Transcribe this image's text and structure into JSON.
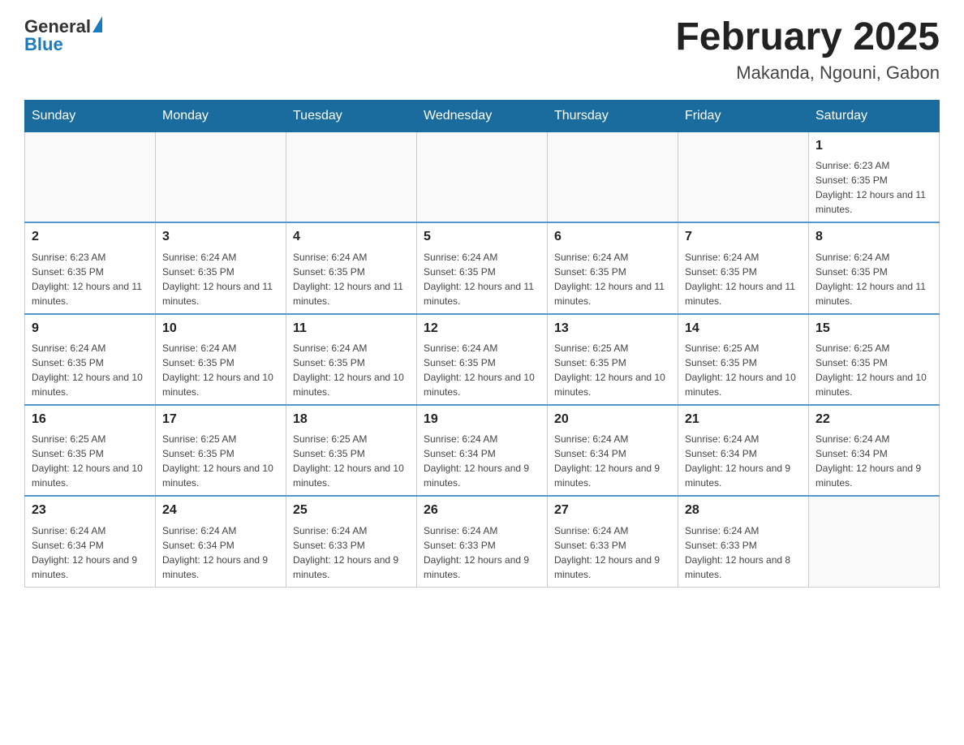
{
  "header": {
    "logo": {
      "general": "General",
      "blue": "Blue"
    },
    "title": "February 2025",
    "subtitle": "Makanda, Ngouni, Gabon"
  },
  "days_of_week": [
    "Sunday",
    "Monday",
    "Tuesday",
    "Wednesday",
    "Thursday",
    "Friday",
    "Saturday"
  ],
  "weeks": [
    [
      {
        "day": "",
        "info": ""
      },
      {
        "day": "",
        "info": ""
      },
      {
        "day": "",
        "info": ""
      },
      {
        "day": "",
        "info": ""
      },
      {
        "day": "",
        "info": ""
      },
      {
        "day": "",
        "info": ""
      },
      {
        "day": "1",
        "info": "Sunrise: 6:23 AM\nSunset: 6:35 PM\nDaylight: 12 hours and 11 minutes."
      }
    ],
    [
      {
        "day": "2",
        "info": "Sunrise: 6:23 AM\nSunset: 6:35 PM\nDaylight: 12 hours and 11 minutes."
      },
      {
        "day": "3",
        "info": "Sunrise: 6:24 AM\nSunset: 6:35 PM\nDaylight: 12 hours and 11 minutes."
      },
      {
        "day": "4",
        "info": "Sunrise: 6:24 AM\nSunset: 6:35 PM\nDaylight: 12 hours and 11 minutes."
      },
      {
        "day": "5",
        "info": "Sunrise: 6:24 AM\nSunset: 6:35 PM\nDaylight: 12 hours and 11 minutes."
      },
      {
        "day": "6",
        "info": "Sunrise: 6:24 AM\nSunset: 6:35 PM\nDaylight: 12 hours and 11 minutes."
      },
      {
        "day": "7",
        "info": "Sunrise: 6:24 AM\nSunset: 6:35 PM\nDaylight: 12 hours and 11 minutes."
      },
      {
        "day": "8",
        "info": "Sunrise: 6:24 AM\nSunset: 6:35 PM\nDaylight: 12 hours and 11 minutes."
      }
    ],
    [
      {
        "day": "9",
        "info": "Sunrise: 6:24 AM\nSunset: 6:35 PM\nDaylight: 12 hours and 10 minutes."
      },
      {
        "day": "10",
        "info": "Sunrise: 6:24 AM\nSunset: 6:35 PM\nDaylight: 12 hours and 10 minutes."
      },
      {
        "day": "11",
        "info": "Sunrise: 6:24 AM\nSunset: 6:35 PM\nDaylight: 12 hours and 10 minutes."
      },
      {
        "day": "12",
        "info": "Sunrise: 6:24 AM\nSunset: 6:35 PM\nDaylight: 12 hours and 10 minutes."
      },
      {
        "day": "13",
        "info": "Sunrise: 6:25 AM\nSunset: 6:35 PM\nDaylight: 12 hours and 10 minutes."
      },
      {
        "day": "14",
        "info": "Sunrise: 6:25 AM\nSunset: 6:35 PM\nDaylight: 12 hours and 10 minutes."
      },
      {
        "day": "15",
        "info": "Sunrise: 6:25 AM\nSunset: 6:35 PM\nDaylight: 12 hours and 10 minutes."
      }
    ],
    [
      {
        "day": "16",
        "info": "Sunrise: 6:25 AM\nSunset: 6:35 PM\nDaylight: 12 hours and 10 minutes."
      },
      {
        "day": "17",
        "info": "Sunrise: 6:25 AM\nSunset: 6:35 PM\nDaylight: 12 hours and 10 minutes."
      },
      {
        "day": "18",
        "info": "Sunrise: 6:25 AM\nSunset: 6:35 PM\nDaylight: 12 hours and 10 minutes."
      },
      {
        "day": "19",
        "info": "Sunrise: 6:24 AM\nSunset: 6:34 PM\nDaylight: 12 hours and 9 minutes."
      },
      {
        "day": "20",
        "info": "Sunrise: 6:24 AM\nSunset: 6:34 PM\nDaylight: 12 hours and 9 minutes."
      },
      {
        "day": "21",
        "info": "Sunrise: 6:24 AM\nSunset: 6:34 PM\nDaylight: 12 hours and 9 minutes."
      },
      {
        "day": "22",
        "info": "Sunrise: 6:24 AM\nSunset: 6:34 PM\nDaylight: 12 hours and 9 minutes."
      }
    ],
    [
      {
        "day": "23",
        "info": "Sunrise: 6:24 AM\nSunset: 6:34 PM\nDaylight: 12 hours and 9 minutes."
      },
      {
        "day": "24",
        "info": "Sunrise: 6:24 AM\nSunset: 6:34 PM\nDaylight: 12 hours and 9 minutes."
      },
      {
        "day": "25",
        "info": "Sunrise: 6:24 AM\nSunset: 6:33 PM\nDaylight: 12 hours and 9 minutes."
      },
      {
        "day": "26",
        "info": "Sunrise: 6:24 AM\nSunset: 6:33 PM\nDaylight: 12 hours and 9 minutes."
      },
      {
        "day": "27",
        "info": "Sunrise: 6:24 AM\nSunset: 6:33 PM\nDaylight: 12 hours and 9 minutes."
      },
      {
        "day": "28",
        "info": "Sunrise: 6:24 AM\nSunset: 6:33 PM\nDaylight: 12 hours and 8 minutes."
      },
      {
        "day": "",
        "info": ""
      }
    ]
  ]
}
